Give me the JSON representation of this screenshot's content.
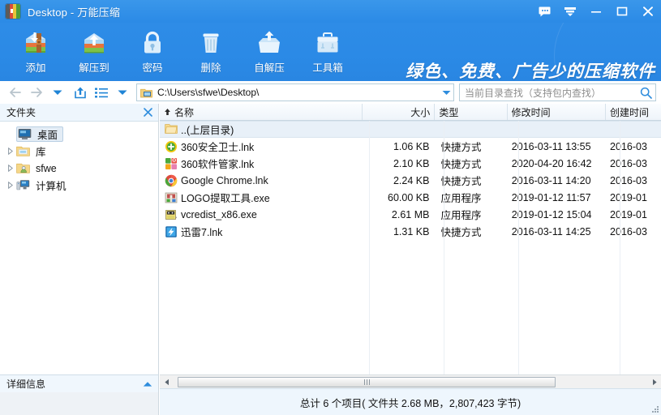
{
  "window": {
    "title": "Desktop - 万能压缩",
    "app_icon": "archive-icon",
    "controls": [
      {
        "name": "feedback-button",
        "icon": "chat-bubble-icon"
      },
      {
        "name": "menu-button",
        "icon": "chevron-down-filled-icon"
      },
      {
        "name": "minimize-button",
        "icon": "minimize-icon"
      },
      {
        "name": "maximize-button",
        "icon": "maximize-icon"
      },
      {
        "name": "close-button",
        "icon": "close-icon"
      }
    ]
  },
  "toolbar": {
    "items": [
      {
        "label": "添加",
        "icon": "archive-add-icon"
      },
      {
        "label": "解压到",
        "icon": "archive-extract-icon"
      },
      {
        "label": "密码",
        "icon": "lock-icon"
      },
      {
        "label": "删除",
        "icon": "trash-icon"
      },
      {
        "label": "自解压",
        "icon": "selfextract-box-icon"
      },
      {
        "label": "工具箱",
        "icon": "toolbox-icon"
      }
    ],
    "slogan": "绿色、免费、广告少的压缩软件"
  },
  "navbar": {
    "back_icon": "arrow-left-icon",
    "forward_icon": "arrow-right-icon",
    "history_icon": "chevron-down-icon",
    "upload_icon": "share-up-icon",
    "view_icon": "list-view-icon",
    "view_caret_icon": "chevron-down-icon",
    "address": {
      "icon": "folder-desktop-icon",
      "value": "C:\\Users\\sfwe\\Desktop\\",
      "caret_icon": "chevron-down-icon"
    },
    "search": {
      "placeholder": "当前目录查找（支持包内查找）",
      "icon": "search-icon"
    }
  },
  "sidebar": {
    "header": "文件夹",
    "close_icon": "close-icon",
    "tree": [
      {
        "label": "桌面",
        "icon": "monitor-icon",
        "selected": true,
        "expandable": false
      },
      {
        "label": "库",
        "icon": "library-folder-icon",
        "selected": false,
        "expandable": true
      },
      {
        "label": "sfwe",
        "icon": "user-folder-icon",
        "selected": false,
        "expandable": true
      },
      {
        "label": "计算机",
        "icon": "computer-icon",
        "selected": false,
        "expandable": true
      }
    ]
  },
  "filelist": {
    "columns": [
      {
        "key": "name",
        "label": "名称",
        "sorted": true,
        "sort_icon": "sort-ascending-icon"
      },
      {
        "key": "size",
        "label": "大小",
        "sorted": false
      },
      {
        "key": "type",
        "label": "类型",
        "sorted": false
      },
      {
        "key": "mtime",
        "label": "修改时间",
        "sorted": false
      },
      {
        "key": "ctime",
        "label": "创建时间",
        "sorted": false
      }
    ],
    "parent_row": {
      "name": "..(上层目录)",
      "icon": "folder-icon"
    },
    "rows": [
      {
        "name": "360安全卫士.lnk",
        "icon": "shield360-icon",
        "size": "1.06 KB",
        "type": "快捷方式",
        "mtime": "2016-03-11 13:55",
        "ctime": "2016-03"
      },
      {
        "name": "360软件管家.lnk",
        "icon": "softmgr360-icon",
        "size": "2.10 KB",
        "type": "快捷方式",
        "mtime": "2020-04-20 16:42",
        "ctime": "2016-03"
      },
      {
        "name": "Google Chrome.lnk",
        "icon": "chrome-icon",
        "size": "2.24 KB",
        "type": "快捷方式",
        "mtime": "2016-03-11 14:20",
        "ctime": "2016-03"
      },
      {
        "name": "LOGO提取工具.exe",
        "icon": "logotool-exe-icon",
        "size": "60.00 KB",
        "type": "应用程序",
        "mtime": "2019-01-12 11:57",
        "ctime": "2019-01"
      },
      {
        "name": "vcredist_x86.exe",
        "icon": "installer-icon",
        "size": "2.61 MB",
        "type": "应用程序",
        "mtime": "2019-01-12 15:04",
        "ctime": "2019-01"
      },
      {
        "name": "迅雷7.lnk",
        "icon": "thunder-icon",
        "size": "1.31 KB",
        "type": "快捷方式",
        "mtime": "2016-03-11 14:25",
        "ctime": "2016-03"
      }
    ]
  },
  "bottom": {
    "details_label": "详细信息",
    "details_chevron_icon": "chevron-up-icon",
    "scroll_left_icon": "triangle-left-icon",
    "scroll_right_icon": "triangle-right-icon",
    "status": "总计 6 个项目( 文件共 2.68 MB，2,807,423 字节)"
  },
  "colors": {
    "titlebar_blue": "#2b8ae6",
    "toolbar_blue": "#2e8ce7",
    "accent": "#1a8ae0",
    "header_bg": "#eef4fa",
    "selected_row": "#e8f0f8"
  }
}
